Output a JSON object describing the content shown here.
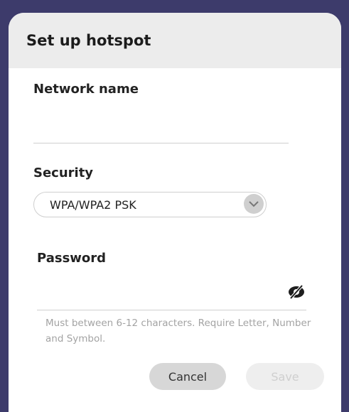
{
  "dialog": {
    "title": "Set up hotspot",
    "network_name": {
      "label": "Network name",
      "value": ""
    },
    "security": {
      "label": "Security",
      "selected": "WPA/WPA2 PSK"
    },
    "password": {
      "label": "Password",
      "value": "",
      "hint": "Must between 6-12 characters. Require Letter, Number and Symbol."
    },
    "buttons": {
      "cancel": "Cancel",
      "save": "Save"
    }
  },
  "icons": {
    "chevron": "chevron-down-icon",
    "visibility": "eye-off-icon"
  },
  "colors": {
    "background": "#3d3b6b",
    "header": "#ececec",
    "hint": "#a3a3a3",
    "save_disabled": "#cfcfcf"
  }
}
